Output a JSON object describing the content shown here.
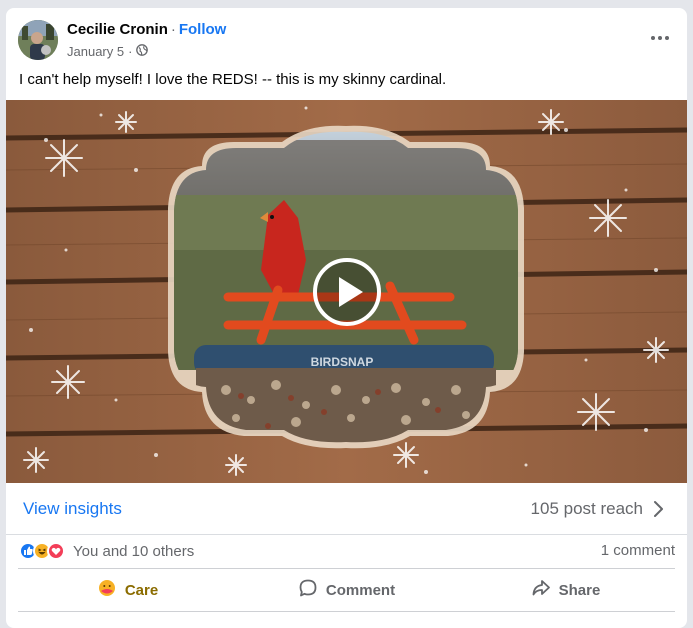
{
  "post": {
    "author": "Cecilie Cronin",
    "separator": "·",
    "follow_label": "Follow",
    "date": "January 5",
    "date_separator": "·",
    "text": "I can't help myself!  I love the REDS!  -- this is my skinny cardinal.",
    "audience_icon": "globe-icon",
    "more_icon": "more-options-icon"
  },
  "media": {
    "type": "video",
    "play_icon": "play-icon",
    "feeder_brand": "BIRDSNAP"
  },
  "insights": {
    "view_label": "View insights",
    "reach_label": "105 post reach"
  },
  "engagement": {
    "reaction_icons": [
      "like-icon",
      "haha-icon",
      "love-icon"
    ],
    "reactions_text": "You and 10 others",
    "comments_text": "1 comment"
  },
  "actions": {
    "care_label": "Care",
    "comment_label": "Comment",
    "share_label": "Share"
  },
  "colors": {
    "link": "#1877f2",
    "secondary_text": "#65676b",
    "care": "#8b6c00",
    "like": "#1877f2",
    "love": "#f33e58",
    "haha": "#f7b125"
  }
}
